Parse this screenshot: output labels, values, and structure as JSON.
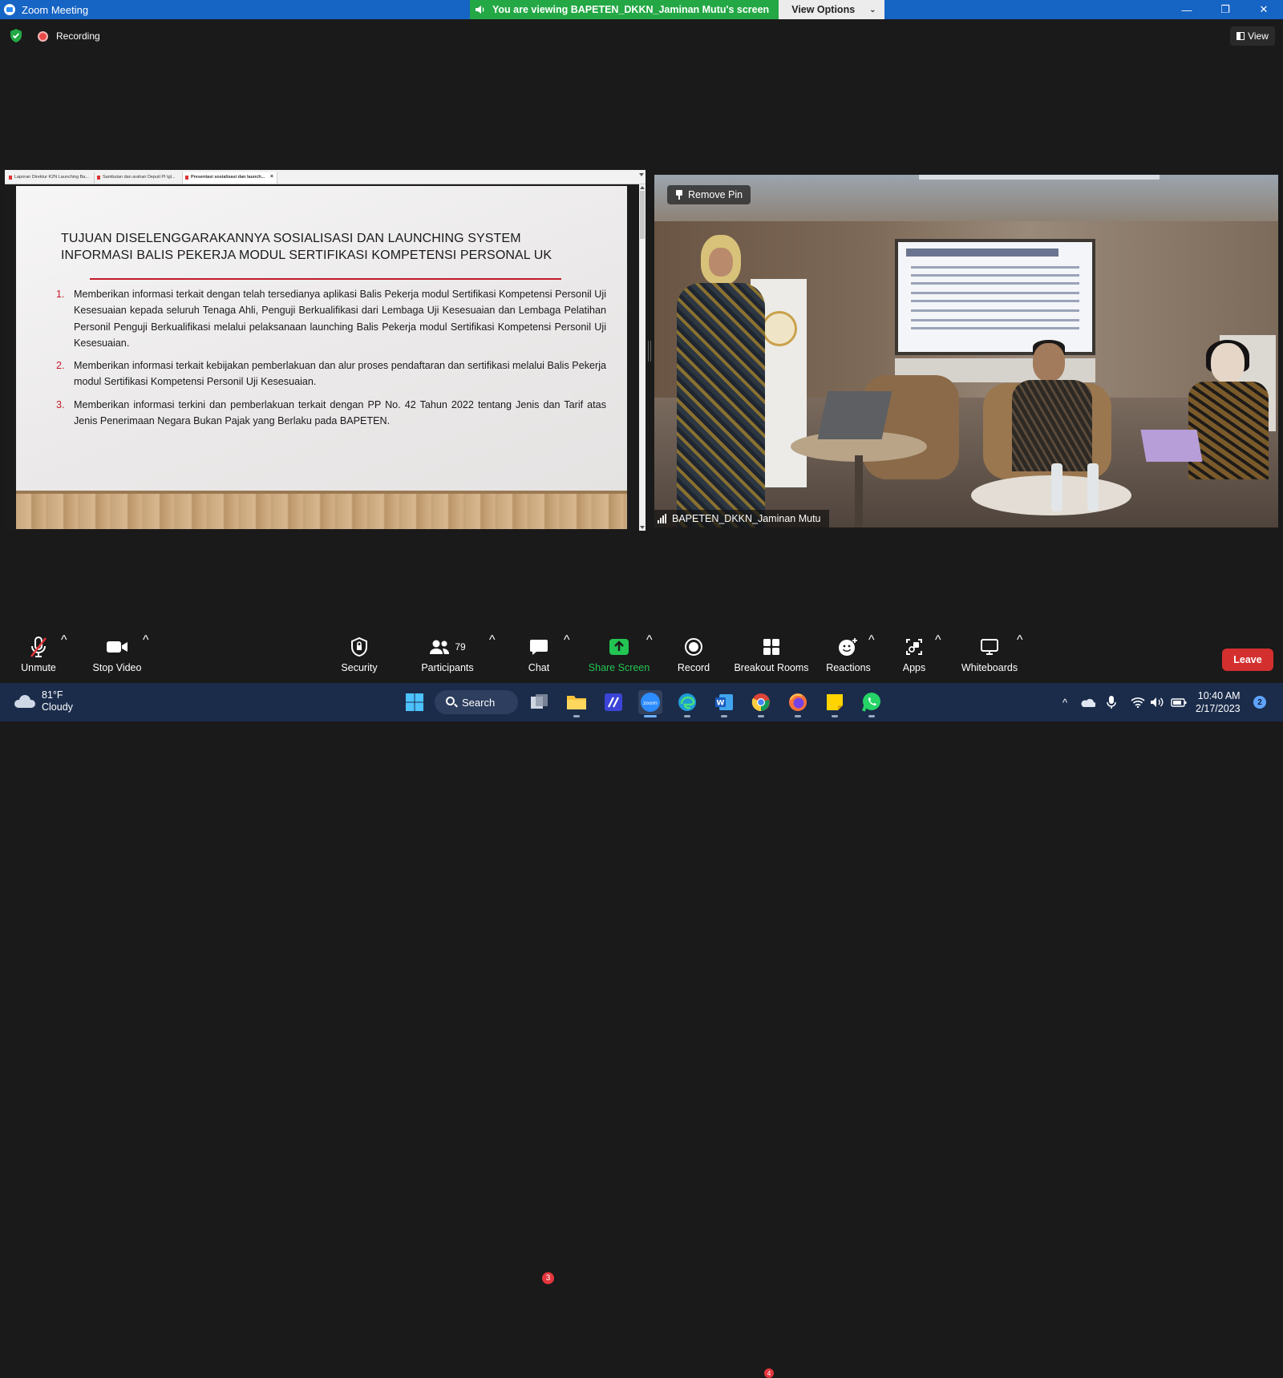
{
  "window": {
    "title": "Zoom Meeting",
    "minimize": "—",
    "maximize": "❐",
    "close": "✕"
  },
  "banner": {
    "viewing_text": "You are viewing BAPETEN_DKKN_Jaminan Mutu's screen",
    "view_options": "View Options"
  },
  "status": {
    "recording_label": "Recording",
    "view_label": "View"
  },
  "shared_screen": {
    "tabs": [
      {
        "label": "Laporan Direktur K2N Launching Ba...",
        "active": false
      },
      {
        "label": "Sambutan dan arahan Deputi PI tgl...",
        "active": false
      },
      {
        "label": "Presentasi sosialisasi dan launch...",
        "active": true
      }
    ],
    "tab_close": "×",
    "slide": {
      "title_line1": "TUJUAN DISELENGGARAKANNYA SOSIALISASI DAN LAUNCHING SYSTEM",
      "title_line2": "INFORMASI BALIS PEKERJA MODUL SERTIFIKASI KOMPETENSI PERSONAL UK",
      "items": [
        {
          "num": "1.",
          "text": "Memberikan informasi terkait dengan telah tersedianya aplikasi Balis Pekerja modul Sertifikasi Kompetensi Personil Uji Kesesuaian kepada seluruh Tenaga Ahli, Penguji Berkualifikasi dari Lembaga Uji Kesesuaian dan Lembaga Pelatihan Personil Penguji Berkualifikasi melalui pelaksanaan launching Balis Pekerja modul Sertifikasi Kompetensi Personil Uji Kesesuaian."
        },
        {
          "num": "2.",
          "text": "Memberikan informasi terkait kebijakan pemberlakuan dan alur proses pendaftaran dan sertifikasi melalui Balis Pekerja modul Sertifikasi Kompetensi Personil Uji Kesesuaian."
        },
        {
          "num": "3.",
          "text": "Memberikan informasi terkini dan pemberlakuan terkait dengan PP No. 42 Tahun 2022 tentang Jenis dan Tarif atas Jenis Penerimaan Negara Bukan Pajak yang Berlaku pada BAPETEN."
        }
      ]
    }
  },
  "video": {
    "remove_pin": "Remove Pin",
    "participant_name": "BAPETEN_DKKN_Jaminan Mutu"
  },
  "toolbar": {
    "unmute": "Unmute",
    "stop_video": "Stop Video",
    "security": "Security",
    "participants": "Participants",
    "participants_count": "79",
    "chat": "Chat",
    "chat_badge": "3",
    "share_screen": "Share Screen",
    "record": "Record",
    "breakout_rooms": "Breakout Rooms",
    "reactions": "Reactions",
    "apps": "Apps",
    "whiteboards": "Whiteboards",
    "leave": "Leave",
    "share_color": "#23c552"
  },
  "taskbar": {
    "temperature": "81°F",
    "weather": "Cloudy",
    "search": "Search",
    "time": "10:40 AM",
    "date": "2/17/2023",
    "notifications": "2",
    "chrome_badge": "4"
  }
}
